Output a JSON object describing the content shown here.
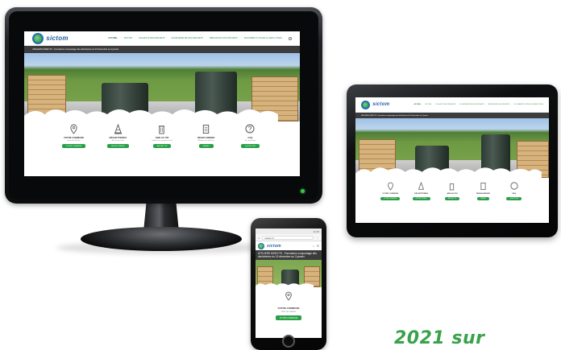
{
  "site": {
    "logo_text": "sictom",
    "nav": [
      "Accueil",
      "Sictom",
      "Collecte des déchets",
      "Le devenir de nos déchets",
      "Réduisons nos déchets",
      "Documents utiles & liens utiles"
    ],
    "banner": "ATELIERS DIRECTS : Formations compostage des déchèteries du 15 décembre au 2 janvier",
    "services": [
      {
        "title": "Votre commune",
        "desc": "Jours de collecte",
        "button": "Votre commune",
        "icon": "map-pin-icon"
      },
      {
        "title": "Déchetteries",
        "desc": "Accès aux sites",
        "button": "Déchetteries",
        "icon": "cone-icon"
      },
      {
        "title": "Aide au tri",
        "desc": "Guide des consignes de tri",
        "button": "Aide au tri",
        "icon": "bin-icon"
      },
      {
        "title": "Refais briser",
        "desc": "Réduire vos déchets",
        "button": "Refais",
        "icon": "document-icon"
      },
      {
        "title": "FAQ",
        "desc": "Vos questions",
        "button": "Questions",
        "icon": "question-icon"
      }
    ]
  },
  "phone": {
    "time": "11:15",
    "url": "sictom.fr",
    "banner": "ATELIERS DIRECTS : Formations compostage des déchèteries du 15 décembre au 2 janvier",
    "service_title": "Votre commune",
    "service_desc": "Jours de collecte",
    "service_button": "Votre commune"
  },
  "tagline": "2021 sur",
  "colors": {
    "accent": "#27a046",
    "brand_blue": "#1f5fa0"
  }
}
